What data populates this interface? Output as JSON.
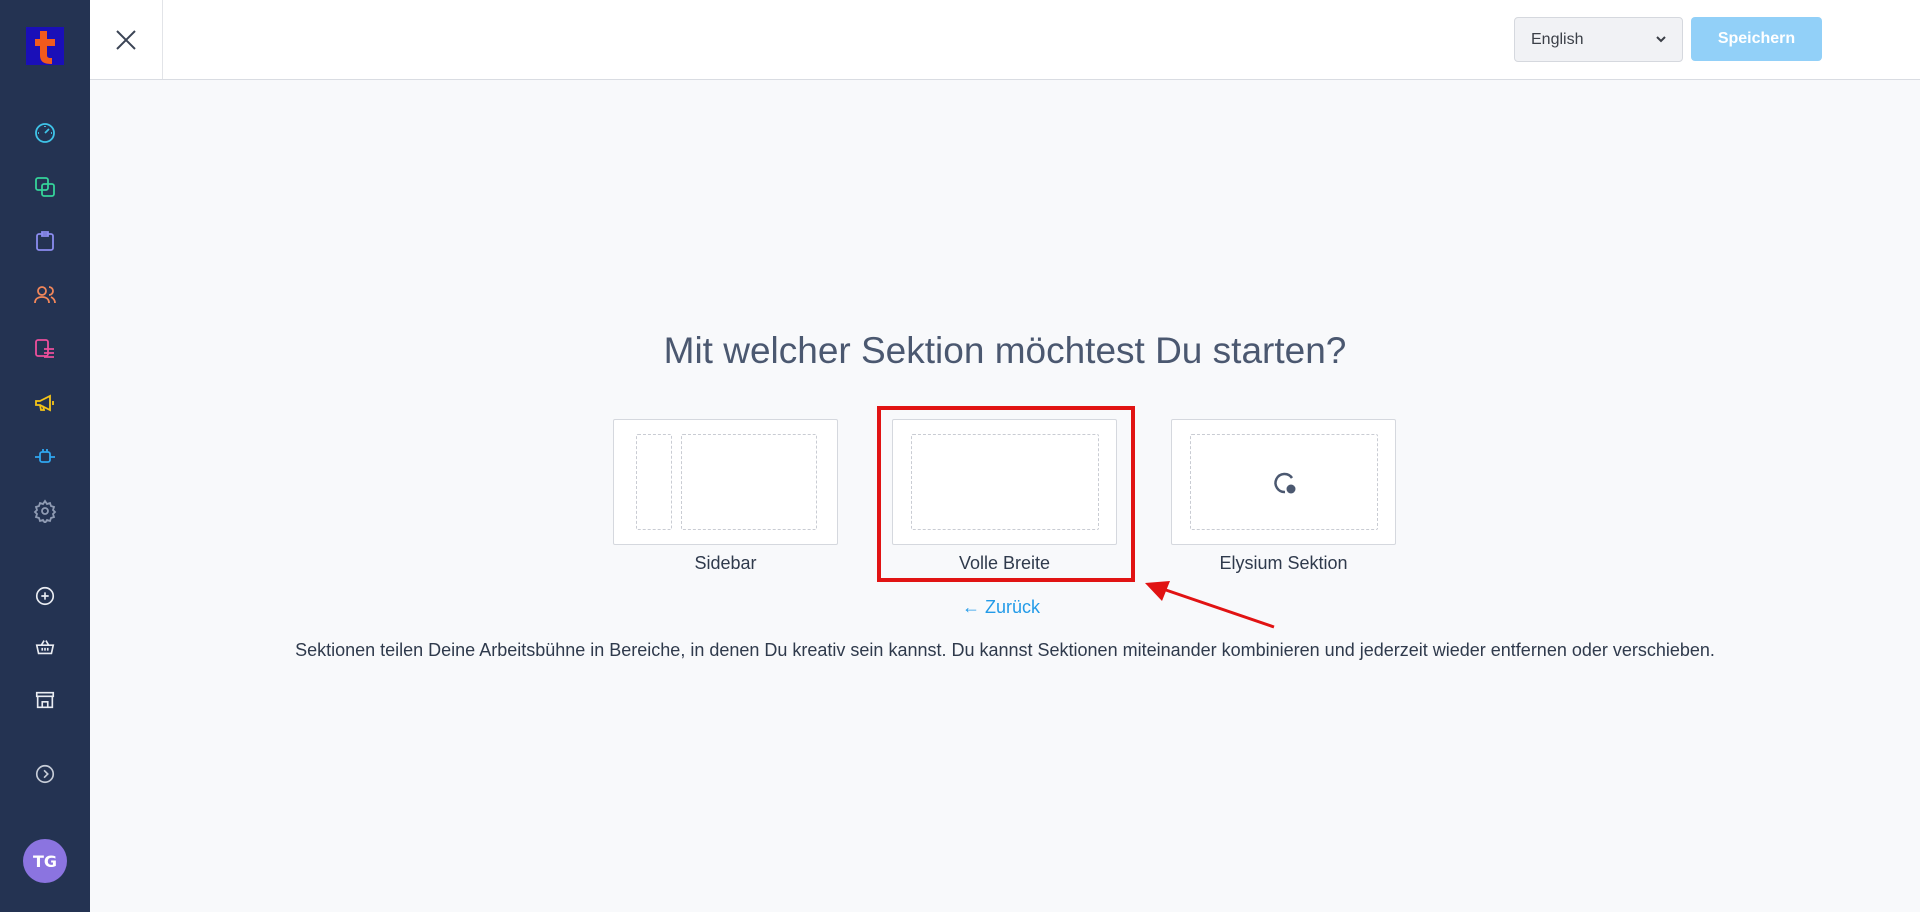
{
  "sidebar": {
    "logo_letter": "t",
    "avatar_initials": "TG",
    "icons": [
      "dashboard-icon",
      "pages-icon",
      "clipboard-icon",
      "users-icon",
      "list-icon",
      "megaphone-icon",
      "plug-icon",
      "gear-icon",
      "plus-circle-icon",
      "basket-icon",
      "store-icon",
      "chevron-right-circle-icon"
    ]
  },
  "topbar": {
    "language": "English",
    "save_label": "Speichern"
  },
  "main": {
    "heading": "Mit welcher Sektion möchtest Du starten?",
    "options": [
      {
        "label": "Sidebar"
      },
      {
        "label": "Volle Breite"
      },
      {
        "label": "Elysium Sektion"
      }
    ],
    "back_label": "← Zurück",
    "description": "Sektionen teilen Deine Arbeitsbühne in Bereiche, in denen Du kreativ sein kannst. Du kannst Sektionen miteinander kombinieren und jederzeit wieder entfernen oder verschieben."
  },
  "colors": {
    "sidebar_bg": "#243352",
    "accent_blue": "#239be8",
    "save_bg": "#92d0f8",
    "highlight": "#e11313",
    "avatar_bg": "#8b74e0"
  }
}
